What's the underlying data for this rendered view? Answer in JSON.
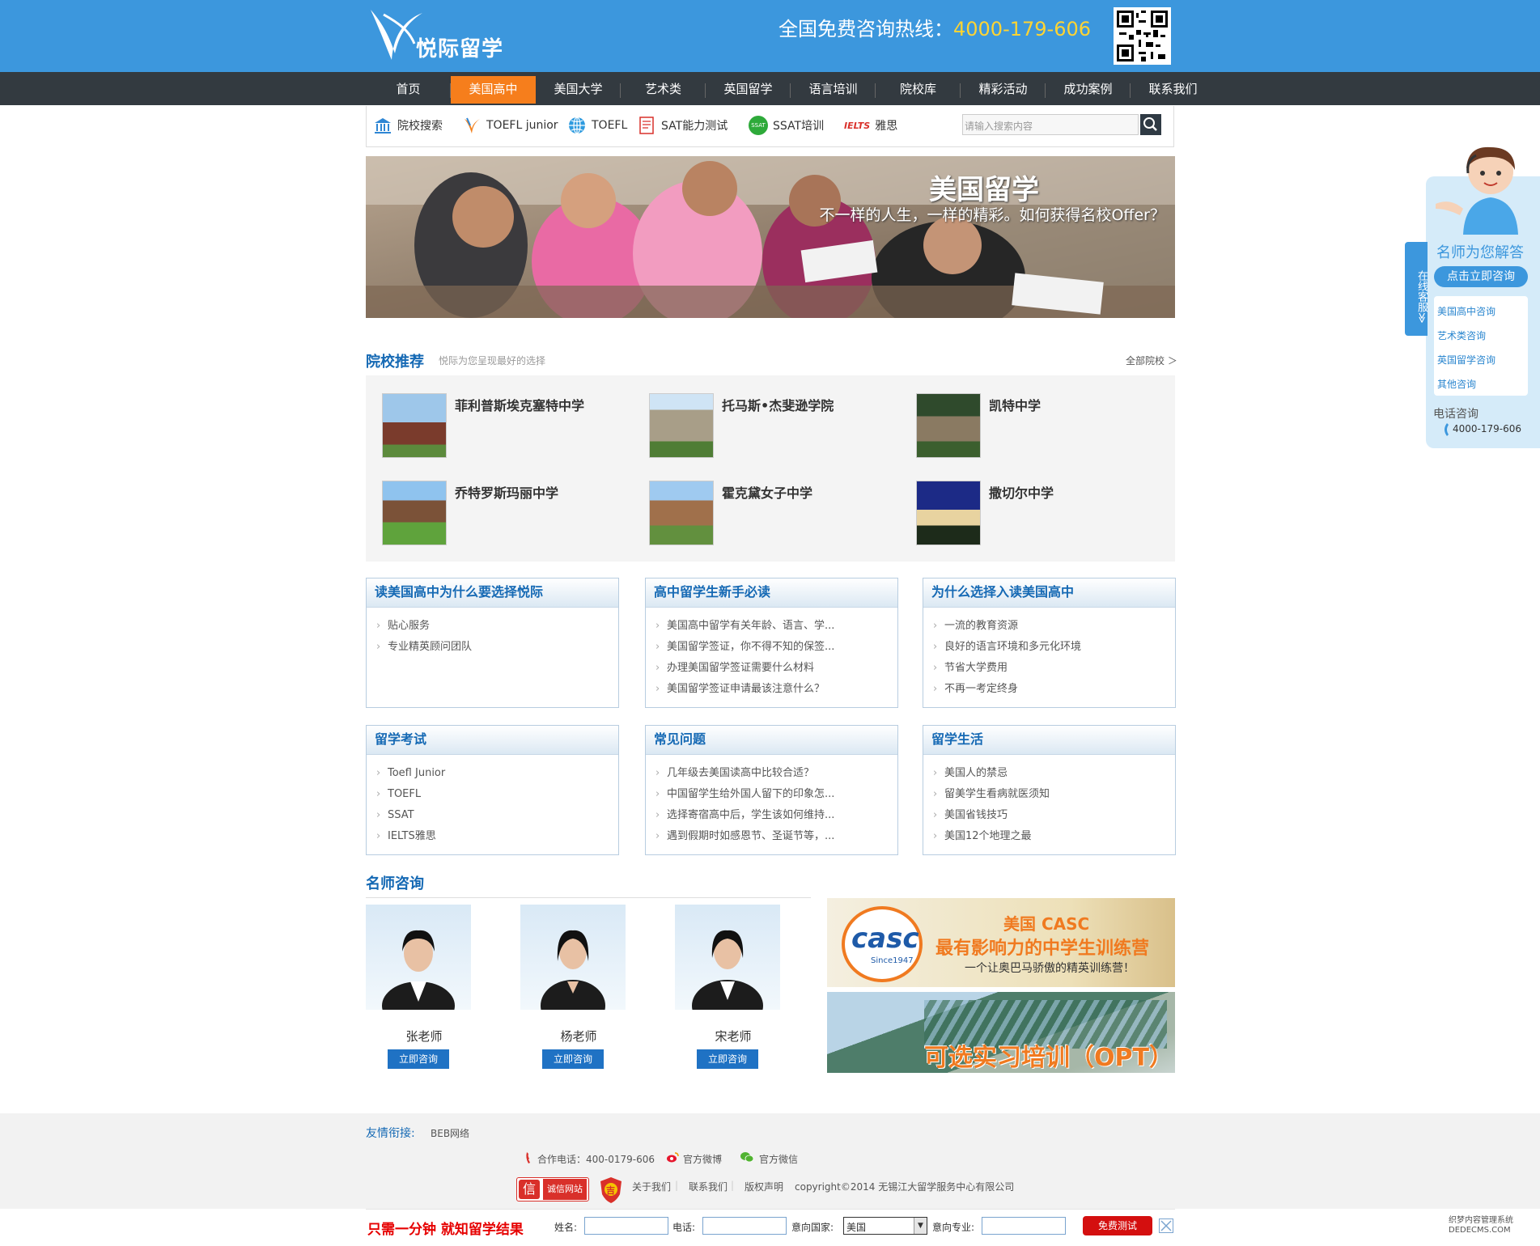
{
  "header": {
    "logo_text": "悦际留学",
    "hotline_label": "全国免费咨询热线：",
    "hotline_number": "4000-179-606"
  },
  "nav": {
    "items": [
      "首页",
      "美国高中",
      "美国大学",
      "艺术类",
      "英国留学",
      "语言培训",
      "院校库",
      "精彩活动",
      "成功案例",
      "联系我们"
    ],
    "active_index": 1
  },
  "subnav": {
    "items": [
      "院校搜索",
      "TOEFL junior",
      "TOEFL",
      "SAT能力测试",
      "SSAT培训",
      "雅思"
    ],
    "ssat_badge": "SSAT",
    "ielts_badge": "IELTS",
    "search_placeholder": "请输入搜索内容"
  },
  "banner": {
    "title": "美国留学",
    "subtitle": "不一样的人生，一样的精彩。如何获得名校Offer？"
  },
  "schools": {
    "title": "院校推荐",
    "subtitle": "悦际为您呈现最好的选择",
    "all_link": "全部院校 ＞",
    "items": [
      "菲利普斯埃克塞特中学",
      "托马斯•杰斐逊学院",
      "凯特中学",
      "乔特罗斯玛丽中学",
      "霍克黛女子中学",
      "撒切尔中学"
    ]
  },
  "boxes": [
    {
      "title": "读美国高中为什么要选择悦际",
      "items": [
        "贴心服务",
        "专业精英顾问团队"
      ]
    },
    {
      "title": "高中留学生新手必读",
      "items": [
        "美国高中留学有关年龄、语言、学...",
        "美国留学签证，你不得不知的保签...",
        "办理美国留学签证需要什么材料",
        "美国留学签证申请最该注意什么？"
      ]
    },
    {
      "title": "为什么选择入读美国高中",
      "items": [
        "一流的教育资源",
        "良好的语言环境和多元化环境",
        "节省大学费用",
        "不再一考定终身"
      ]
    },
    {
      "title": "留学考试",
      "items": [
        "Toefl Junior",
        "TOEFL",
        "SSAT",
        "IELTS雅思"
      ]
    },
    {
      "title": "常见问题",
      "items": [
        "几年级去美国读高中比较合适？",
        "中国留学生给外国人留下的印象怎...",
        "选择寄宿高中后，学生该如何维持...",
        "遇到假期时如感恩节、圣诞节等，..."
      ]
    },
    {
      "title": "留学生活",
      "items": [
        "美国人的禁忌",
        "留美学生看病就医须知",
        "美国省钱技巧",
        "美国12个地理之最"
      ]
    }
  ],
  "teachers": {
    "title": "名师咨询",
    "items": [
      {
        "name": "张老师",
        "button": "立即咨询"
      },
      {
        "name": "杨老师",
        "button": "立即咨询"
      },
      {
        "name": "宋老师",
        "button": "立即咨询"
      }
    ]
  },
  "ads": {
    "casc_logo": "casc",
    "casc_since": "Since1947",
    "casc_title": "美国 CASC",
    "casc_line": "最有影响力的中学生训练营",
    "casc_tag": "一个让奥巴马骄傲的精英训练营！",
    "opt_text": "可选实习培训（OPT）"
  },
  "footer": {
    "friend_label": "友情衔接:",
    "friend_link": "BEB网络",
    "phone": "合作电话：400-0179-606",
    "weibo": "官方微博",
    "weixin": "官方微信",
    "cert_label": "诚信网站",
    "cert_char": "信",
    "badge_char": "吉",
    "links": [
      "关于我们",
      "联系我们",
      "版权声明"
    ],
    "copyright": "copyright©2014 无锡江大留学服务中心有限公司"
  },
  "bottom_bar": {
    "slogan": "只需一分钟  就知留学结果",
    "name_label": "姓名:",
    "phone_label": "电话:",
    "country_label": "意向国家:",
    "country_value": "美国",
    "major_label": "意向专业:",
    "submit": "免费测试"
  },
  "float_service": {
    "tab_text": "在线客服≫",
    "title": "名师为您解答",
    "button": "点击立即咨询",
    "items": [
      "美国高中咨询",
      "艺术类咨询",
      "英国留学咨询",
      "其他咨询"
    ],
    "phone_title": "电话咨询",
    "phone": "4000-179-606"
  },
  "watermark": "织梦内容管理系统 DEDECMS.COM",
  "colors": {
    "brand_blue": "#3c97dd",
    "nav_dark": "#333a40",
    "active_orange": "#f67e1c",
    "title_blue": "#1569b4",
    "submit_red": "#d40f0f"
  }
}
